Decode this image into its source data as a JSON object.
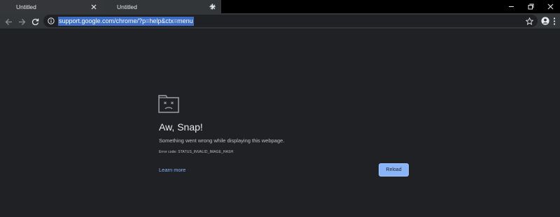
{
  "tabs": [
    {
      "title": "Untitled",
      "active": false
    },
    {
      "title": "Untitled",
      "active": true
    }
  ],
  "icons": {
    "tab_close": "close-icon",
    "new_tab": "plus-icon",
    "window_minimize": "minimize-icon",
    "window_restore": "restore-icon",
    "window_close": "close-icon",
    "back": "arrow-left-icon",
    "forward": "arrow-right-icon",
    "refresh": "refresh-icon",
    "site_info": "info-icon",
    "bookmark": "star-icon",
    "profile": "account-circle-icon",
    "menu": "kebab-menu-icon",
    "sad_tab": "sad-tab-icon"
  },
  "omnibox": {
    "url": "support.google.com/chrome/?p=help&ctx=menu",
    "selected": true
  },
  "error_page": {
    "title": "Aw, Snap!",
    "message": "Something went wrong while displaying this webpage.",
    "error_code": "Error code: STATUS_INVALID_IMAGE_HASH",
    "learn_more_label": "Learn more",
    "reload_label": "Reload"
  },
  "colors": {
    "background": "#202124",
    "tab_strip": "#000000",
    "toolbar": "#323639",
    "selection": "#3e6dc5",
    "link": "#8ab4f8",
    "button": "#8ab4f8"
  }
}
